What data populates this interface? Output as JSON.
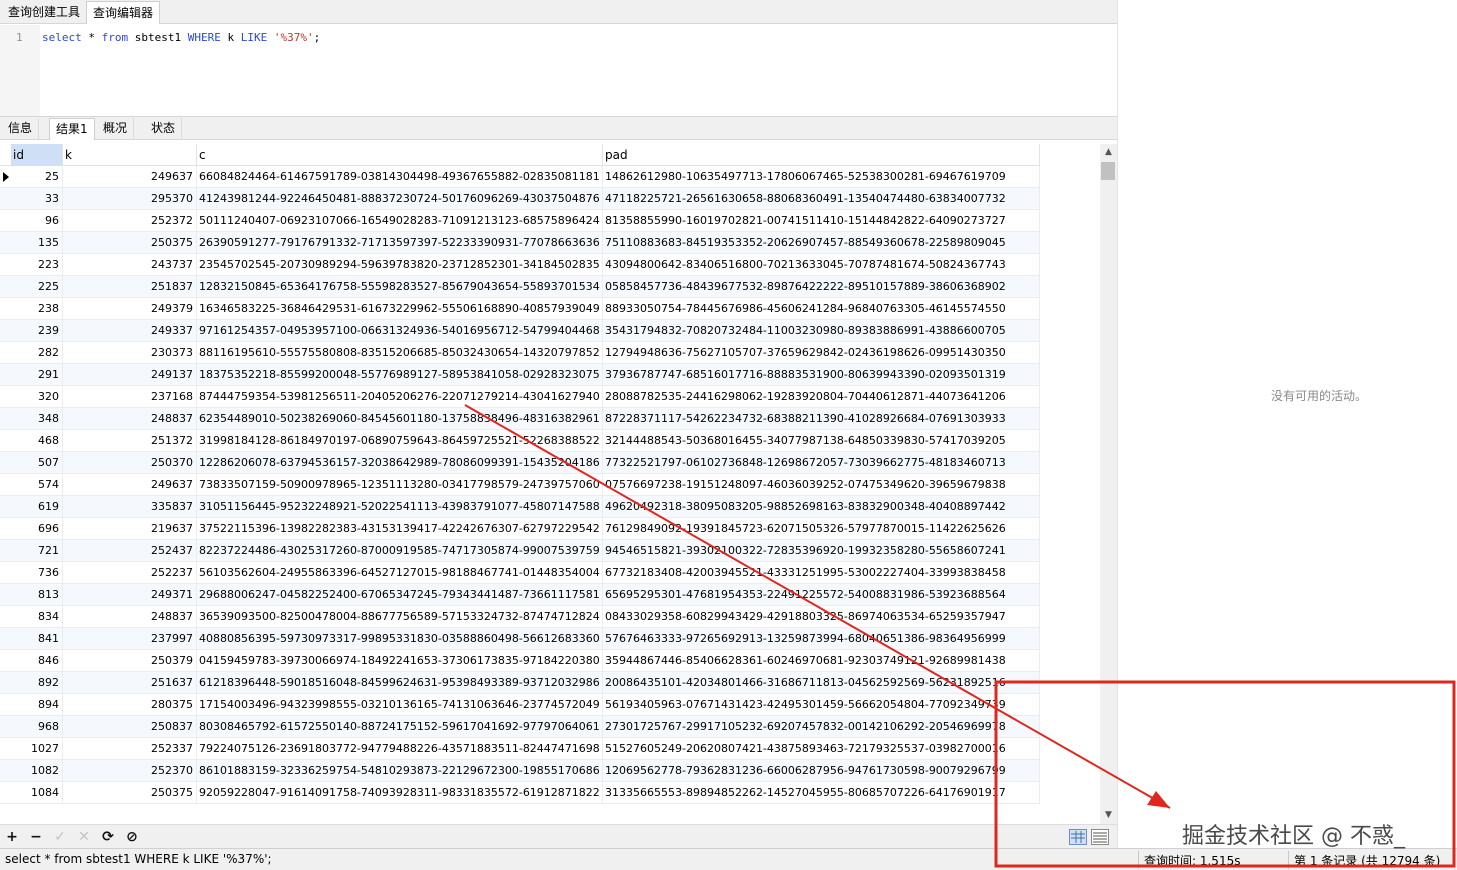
{
  "top_tabs": [
    "查询创建工具",
    "查询编辑器"
  ],
  "editor": {
    "line_number": "1",
    "tokens": {
      "kw_select": "select",
      "star": " * ",
      "kw_from": "from",
      "table": " sbtest1 ",
      "kw_where": "WHERE",
      "col": " k ",
      "kw_like": "LIKE",
      "space": " ",
      "pattern": "'%37%'",
      "semi": ";"
    }
  },
  "result_tabs": [
    "信息",
    "结果1",
    "概况",
    "状态"
  ],
  "grid": {
    "columns": [
      "id",
      "k",
      "c",
      "pad"
    ],
    "rows": [
      [
        "25",
        "249637",
        "66084824464-61467591789-03814304498-49367655882-02835081181",
        "14862612980-10635497713-17806067465-52538300281-69467619709"
      ],
      [
        "33",
        "295370",
        "41243981244-92246450481-88837230724-50176096269-43037504876",
        "47118225721-26561630658-88068360491-13540474480-63834007732"
      ],
      [
        "96",
        "252372",
        "50111240407-06923107066-16549028283-71091213123-68575896424",
        "81358855990-16019702821-00741511410-15144842822-64090273727"
      ],
      [
        "135",
        "250375",
        "26390591277-79176791332-71713597397-52233390931-77078663636",
        "75110883683-84519353352-20626907457-88549360678-22589809045"
      ],
      [
        "223",
        "243737",
        "23545702545-20730989294-59639783820-23712852301-34184502835",
        "43094800642-83406516800-70213633045-70787481674-50824367743"
      ],
      [
        "225",
        "251837",
        "12832150845-65364176758-55598283527-85679043654-55893701534",
        "05858457736-48439677532-89876422222-89510157889-38606368902"
      ],
      [
        "238",
        "249379",
        "16346583225-36846429531-61673229962-55506168890-40857939049",
        "88933050754-78445676986-45606241284-96840763305-46145574550"
      ],
      [
        "239",
        "249337",
        "97161254357-04953957100-06631324936-54016956712-54799404468",
        "35431794832-70820732484-11003230980-89383886991-43886600705"
      ],
      [
        "282",
        "230373",
        "88116195610-55575580808-83515206685-85032430654-14320797852",
        "12794948636-75627105707-37659629842-02436198626-09951430350"
      ],
      [
        "291",
        "249137",
        "18375352218-85599200048-55776989127-58953841058-02928323075",
        "37936787747-68516017716-88883531900-80639943390-02093501319"
      ],
      [
        "320",
        "237168",
        "87444759354-53981256511-20405206276-22071279214-43041627940",
        "28088782535-24416298062-19283920804-70440612871-44073641206"
      ],
      [
        "348",
        "248837",
        "62354489010-50238269060-84545601180-13758838496-48316382961",
        "87228371117-54262234732-68388211390-41028926684-07691303933"
      ],
      [
        "468",
        "251372",
        "31998184128-86184970197-06890759643-86459725521-52268388522",
        "32144488543-50368016455-34077987138-64850339830-57417039205"
      ],
      [
        "507",
        "250370",
        "12286206078-63794536157-32038642989-78086099391-15435204186",
        "77322521797-06102736848-12698672057-73039662775-48183460713"
      ],
      [
        "574",
        "249637",
        "73833507159-50900978965-12351113280-03417798579-24739757060",
        "07576697238-19151248097-46036039252-07475349620-39659679838"
      ],
      [
        "619",
        "335837",
        "31051156445-95232248921-52022541113-43983791077-45807147588",
        "49620492318-38095083205-98852698163-83832900348-40408897442"
      ],
      [
        "696",
        "219637",
        "37522115396-13982282383-43153139417-42242676307-62797229542",
        "76129849092-19391845723-62071505326-57977870015-11422625626"
      ],
      [
        "721",
        "252437",
        "82237224486-43025317260-87000919585-74717305874-99007539759",
        "94546515821-39302100322-72835396920-19932358280-55658607241"
      ],
      [
        "736",
        "252237",
        "56103562604-24955863396-64527127015-98188467741-01448354004",
        "67732183408-42003945521-43331251995-53002227404-33993838458"
      ],
      [
        "813",
        "249371",
        "29688006247-04582252400-67065347245-79343441487-73661117581",
        "65695295301-47681954353-22491225572-54008831986-53923688564"
      ],
      [
        "834",
        "248837",
        "36539093500-82500478004-88677756589-57153324732-87474712824",
        "08433029358-60829943429-42918803325-86974063534-65259357947"
      ],
      [
        "841",
        "237997",
        "40880856395-59730973317-99895331830-03588860498-56612683360",
        "57676463333-97265692913-13259873994-68040651386-98364956999"
      ],
      [
        "846",
        "250379",
        "04159459783-39730066974-18492241653-37306173835-97184220380",
        "35944867446-85406628361-60246970681-92303749121-92689981438"
      ],
      [
        "892",
        "251637",
        "61218396448-59018516048-84599624631-95398493389-93712032986",
        "20086435101-42034801466-31686711813-04562592569-56231892516"
      ],
      [
        "894",
        "280375",
        "17154003496-94323998555-03210136165-74131063646-23774572049",
        "56193405963-07671431423-42495301459-56662054804-77092349739"
      ],
      [
        "968",
        "250837",
        "80308465792-61572550140-88724175152-59617041692-97797064061",
        "27301725767-29917105232-69207457832-00142106292-20546969978"
      ],
      [
        "1027",
        "252337",
        "79224075126-23691803772-94779488226-43571883511-82447471698",
        "51527605249-20620807421-43875893463-72179325537-03982700016"
      ],
      [
        "1082",
        "252370",
        "86101883159-32336259754-54810293873-22129672300-19855170686",
        "12069562778-79362831236-66006287956-94761730598-90079296799"
      ],
      [
        "1084",
        "250375",
        "92059228047-91614091758-74093928311-98331835572-61912871822",
        "31335665553-89894852262-14527045955-80685707226-64176901917"
      ]
    ]
  },
  "right_pane": {
    "no_activity": "没有可用的活动。"
  },
  "toolbar": {
    "add": "+",
    "delete": "−",
    "apply": "✓",
    "discard": "✕",
    "refresh": "⟳",
    "stop": "⊘"
  },
  "status": {
    "sql": "select * from sbtest1 WHERE k LIKE '%37%';",
    "query_time": "查询时间: 1.515s",
    "records": "第 1 条记录 (共 12794 条)"
  },
  "watermark": "掘金技术社区 @ 不惑_",
  "annotation": {
    "arrow_color": "#e0271f",
    "box_color": "#e0271f"
  },
  "icons": [
    "row-marker-icon",
    "grid-view-icon",
    "form-view-icon",
    "scroll-up-icon",
    "scroll-down-icon"
  ]
}
